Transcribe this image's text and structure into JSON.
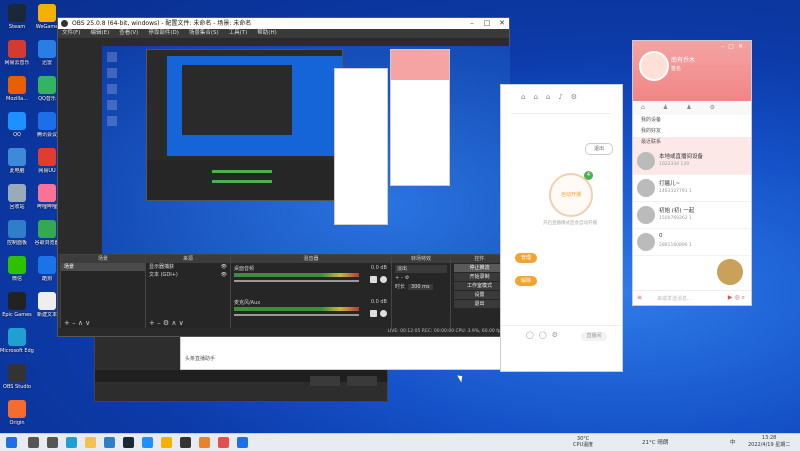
{
  "desktop": {
    "icons": [
      {
        "label": "Steam",
        "name": "steam-icon",
        "color": "#1b2838"
      },
      {
        "label": "网易云音乐",
        "name": "music-app-icon",
        "color": "#d33a31"
      },
      {
        "label": "Mozilla...",
        "name": "browser-icon",
        "color": "#e66000"
      },
      {
        "label": "QQ",
        "name": "qq-icon",
        "color": "#1e90ff"
      },
      {
        "label": "此电脑",
        "name": "computer-icon",
        "color": "#3c8ad8"
      },
      {
        "label": "回收站",
        "name": "recycle-bin-icon",
        "color": "#9ab"
      },
      {
        "label": "控制面板",
        "name": "control-panel-icon",
        "color": "#2f7ec7"
      },
      {
        "label": "微信",
        "name": "wechat-icon",
        "color": "#2dc100"
      },
      {
        "label": "Epic Games",
        "name": "epic-games-icon",
        "color": "#222"
      },
      {
        "label": "Microsoft Edge",
        "name": "edge-icon",
        "color": "#1fa0d0"
      },
      {
        "label": "OBS Studio",
        "name": "obs-icon",
        "color": "#333"
      },
      {
        "label": "Origin",
        "name": "origin-icon",
        "color": "#f56c2d"
      }
    ],
    "icons_col2": [
      {
        "label": "WeGame",
        "name": "wegame-icon",
        "color": "#f6b100"
      },
      {
        "label": "迅雷",
        "name": "thunder-icon",
        "color": "#2a7de1"
      },
      {
        "label": "QQ音乐",
        "name": "qq-music-icon",
        "color": "#33b463"
      },
      {
        "label": "腾讯会议",
        "name": "meeting-icon",
        "color": "#1c6fe8"
      },
      {
        "label": "网易UU",
        "name": "uu-icon",
        "color": "#e03c31"
      },
      {
        "label": "哔哩哔哩",
        "name": "bilibili-icon",
        "color": "#fb7299"
      },
      {
        "label": "谷歌浏览器",
        "name": "chrome-icon",
        "color": "#34a853"
      },
      {
        "label": "酷狗",
        "name": "kugou-icon",
        "color": "#1a73e8"
      },
      {
        "label": "新建文本",
        "name": "text-file-icon",
        "color": "#eee"
      }
    ]
  },
  "obs": {
    "title": "OBS 25.0.8 (64-bit, windows) - 配置文件: 未命名 - 场景: 未命名",
    "menu": [
      "文件(F)",
      "编辑(E)",
      "查看(V)",
      "停靠部件(D)",
      "场景集合(S)",
      "工具(T)",
      "帮助(H)"
    ],
    "docks": {
      "scenes": "场景",
      "sources": "来源",
      "mixer": "混音器",
      "transitions": "转场特效",
      "controls": "控件"
    },
    "scene_item": "场景",
    "sources": [
      "显示器捕获",
      "文本 (GDI+)"
    ],
    "mixer_tracks": [
      {
        "name": "桌面音频",
        "level": "0.0 dB"
      },
      {
        "name": "麦克风/Aux",
        "level": "0.0 dB"
      }
    ],
    "transition": "淡出",
    "duration_label": "时长",
    "duration_value": "300 ms",
    "controls": [
      "停止推流",
      "开始录制",
      "工作室模式",
      "设置",
      "退出"
    ],
    "status": "LIVE: 00:12:05   REC: 00:00:00   CPU: 3.9%, 60.00 fps"
  },
  "appwin": {
    "exit_label": "退出",
    "circle_label": "自动开播",
    "circle_badge": "4",
    "hint": "开启直播模式后会自动开播",
    "btn1": "管理",
    "btn2": "解除",
    "footer": "直播间"
  },
  "chat": {
    "title": "南有乔木",
    "sub": "签名",
    "section_label": "我的好友",
    "rows": [
      {
        "name": "我的设备",
        "sub": ""
      },
      {
        "name": "我的好友",
        "sub": ""
      },
      {
        "name": "最近联系",
        "sub": ""
      },
      {
        "name": "本地或直播间设备",
        "sub": "1022334   139"
      },
      {
        "name": "打瞌儿~",
        "sub": "1483327791   1"
      },
      {
        "name": "初始 (初) 一起",
        "sub": "1500769262   1"
      },
      {
        "name": "0",
        "sub": "2881160896   1"
      }
    ],
    "input_placeholder": "来或发送消息..."
  },
  "taskbar": {
    "weather": "21°C 晴朗",
    "cpu": "30°C",
    "cpu_label": "CPU温度",
    "time": "13:28",
    "date": "2022/4/19 星期二",
    "lang": "中",
    "apps": [
      {
        "name": "search-icon",
        "color": "#555"
      },
      {
        "name": "task-view-icon",
        "color": "#555"
      },
      {
        "name": "edge-taskbar-icon",
        "color": "#1fa0d0"
      },
      {
        "name": "explorer-icon",
        "color": "#f2c14e"
      },
      {
        "name": "store-icon",
        "color": "#2f7ec7"
      },
      {
        "name": "steam-taskbar-icon",
        "color": "#1b2838"
      },
      {
        "name": "qq-taskbar-icon",
        "color": "#1e90ff"
      },
      {
        "name": "wegame-taskbar-icon",
        "color": "#f6b100"
      },
      {
        "name": "obs-taskbar-icon",
        "color": "#333"
      },
      {
        "name": "game-taskbar-icon",
        "color": "#e7842a"
      },
      {
        "name": "chat-taskbar-icon",
        "color": "#e05050"
      },
      {
        "name": "app-taskbar-icon",
        "color": "#1c6fe8"
      }
    ]
  }
}
